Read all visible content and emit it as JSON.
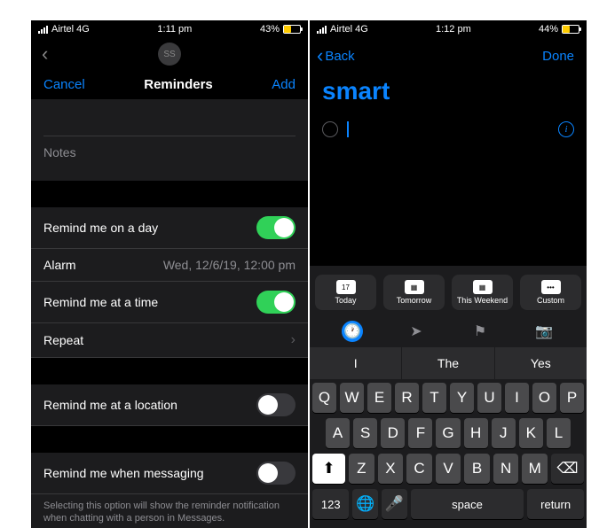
{
  "left": {
    "status": {
      "carrier": "Airtel 4G",
      "time": "1:11 pm",
      "battery": "43%"
    },
    "avatar_initials": "SS",
    "toolbar": {
      "cancel": "Cancel",
      "title": "Reminders",
      "add": "Add"
    },
    "notes_placeholder": "Notes",
    "settings": {
      "remind_day": "Remind me on a day",
      "alarm_label": "Alarm",
      "alarm_value": "Wed, 12/6/19, 12:00 pm",
      "remind_time": "Remind me at a time",
      "repeat": "Repeat",
      "remind_location": "Remind me at a location",
      "remind_messaging": "Remind me when messaging",
      "messaging_hint": "Selecting this option will show the reminder notification when chatting with a person in Messages."
    }
  },
  "right": {
    "status": {
      "carrier": "Airtel 4G",
      "time": "1:12 pm",
      "battery": "44%"
    },
    "nav": {
      "back": "Back",
      "done": "Done"
    },
    "list_title": "smart",
    "quick": {
      "today": "Today",
      "today_num": "17",
      "tomorrow": "Tomorrow",
      "weekend": "This Weekend",
      "custom": "Custom"
    },
    "suggestions": [
      "I",
      "The",
      "Yes"
    ],
    "keys": {
      "row1": [
        "Q",
        "W",
        "E",
        "R",
        "T",
        "Y",
        "U",
        "I",
        "O",
        "P"
      ],
      "row2": [
        "A",
        "S",
        "D",
        "F",
        "G",
        "H",
        "J",
        "K",
        "L"
      ],
      "row3": [
        "Z",
        "X",
        "C",
        "V",
        "B",
        "N",
        "M"
      ],
      "num": "123",
      "space": "space",
      "return": "return"
    }
  }
}
